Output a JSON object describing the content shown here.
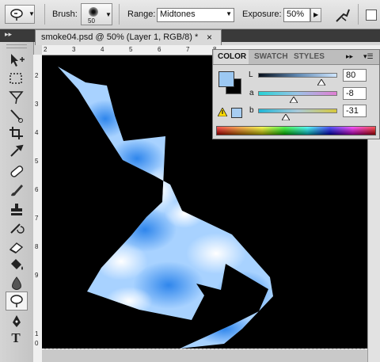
{
  "options_bar": {
    "brush_label": "Brush:",
    "brush_size": "50",
    "range_label": "Range:",
    "range_value": "Midtones",
    "exposure_label": "Exposure:",
    "exposure_value": "50%"
  },
  "document": {
    "tab_title": "smoke04.psd @ 50% (Layer 1, RGB/8) *",
    "close_glyph": "×",
    "ruler_top": [
      "2",
      "3",
      "4",
      "5",
      "6",
      "7",
      "8"
    ],
    "ruler_left": [
      "2",
      "3",
      "4",
      "5",
      "6",
      "7",
      "8",
      "9",
      "1",
      "0"
    ]
  },
  "color_panel": {
    "tabs": [
      "COLOR",
      "SWATCH",
      "STYLES"
    ],
    "channels": [
      {
        "label": "L",
        "value": "80",
        "position": 0.8
      },
      {
        "label": "a",
        "value": "-8",
        "position": 0.45
      },
      {
        "label": "b",
        "value": "-31",
        "position": 0.35
      }
    ]
  },
  "tools": [
    "move-tool",
    "marquee-tool",
    "lasso-tool",
    "quick-selection-tool",
    "crop-tool",
    "eyedropper-tool",
    "spot-healing-tool",
    "brush-tool",
    "clone-stamp-tool",
    "history-brush-tool",
    "eraser-tool",
    "paint-bucket-tool",
    "blur-tool",
    "dodge-tool",
    "pen-tool",
    "type-tool"
  ],
  "colors": {
    "foreground": "#9cc8f2",
    "background": "#000000",
    "shape_light": "#c5e3ff",
    "shape_dark": "#3d8fe8"
  }
}
